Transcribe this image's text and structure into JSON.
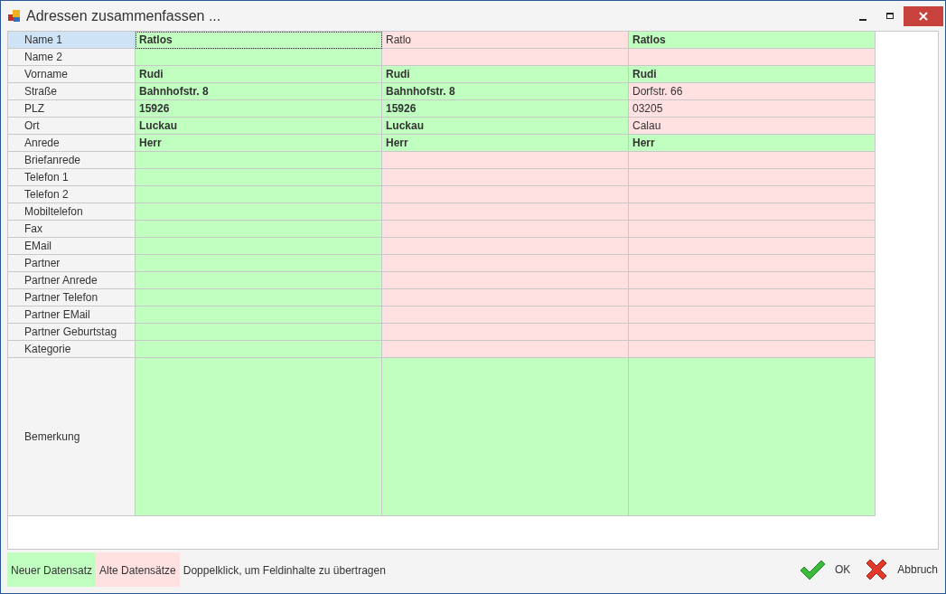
{
  "window": {
    "title": "Adressen zusammenfassen ..."
  },
  "grid": {
    "rows": [
      {
        "label": "Name 1",
        "selected": true,
        "cells": [
          {
            "text": "Ratlos",
            "match": true,
            "focused": true
          },
          {
            "text": "Ratlo",
            "match": false,
            "focused": false
          },
          {
            "text": "Ratlos",
            "match": true,
            "focused": false
          }
        ]
      },
      {
        "label": "Name 2",
        "selected": false,
        "cells": [
          {
            "match": true,
            "focused": false
          },
          {
            "match": false,
            "focused": false
          },
          {
            "match": false,
            "focused": false
          }
        ]
      },
      {
        "label": "Vorname",
        "selected": false,
        "cells": [
          {
            "text": "Rudi",
            "match": true,
            "focused": false
          },
          {
            "text": "Rudi",
            "match": true,
            "focused": false
          },
          {
            "text": "Rudi",
            "match": true,
            "focused": false
          }
        ]
      },
      {
        "label": "Straße",
        "selected": false,
        "cells": [
          {
            "text": "Bahnhofstr. 8",
            "match": true,
            "focused": false
          },
          {
            "text": "Bahnhofstr. 8",
            "match": true,
            "focused": false
          },
          {
            "text": "Dorfstr. 66",
            "match": false,
            "focused": false
          }
        ]
      },
      {
        "label": "PLZ",
        "selected": false,
        "cells": [
          {
            "text": "15926",
            "match": true,
            "focused": false
          },
          {
            "text": "15926",
            "match": true,
            "focused": false
          },
          {
            "text": "03205",
            "match": false,
            "focused": false
          }
        ]
      },
      {
        "label": "Ort",
        "selected": false,
        "cells": [
          {
            "text": "Luckau",
            "match": true,
            "focused": false
          },
          {
            "text": "Luckau",
            "match": true,
            "focused": false
          },
          {
            "text": "Calau",
            "match": false,
            "focused": false
          }
        ]
      },
      {
        "label": "Anrede",
        "selected": false,
        "cells": [
          {
            "text": "Herr",
            "match": true,
            "focused": false
          },
          {
            "text": "Herr",
            "match": true,
            "focused": false
          },
          {
            "text": "Herr",
            "match": true,
            "focused": false
          }
        ]
      },
      {
        "label": "Briefanrede",
        "selected": false,
        "cells": [
          {
            "match": true,
            "focused": false
          },
          {
            "match": false,
            "focused": false
          },
          {
            "match": false,
            "focused": false
          }
        ]
      },
      {
        "label": "Telefon 1",
        "selected": false,
        "cells": [
          {
            "match": true,
            "focused": false
          },
          {
            "match": false,
            "focused": false
          },
          {
            "match": false,
            "focused": false
          }
        ]
      },
      {
        "label": "Telefon 2",
        "selected": false,
        "cells": [
          {
            "match": true,
            "focused": false
          },
          {
            "match": false,
            "focused": false
          },
          {
            "match": false,
            "focused": false
          }
        ]
      },
      {
        "label": "Mobiltelefon",
        "selected": false,
        "cells": [
          {
            "match": true,
            "focused": false
          },
          {
            "match": false,
            "focused": false
          },
          {
            "match": false,
            "focused": false
          }
        ]
      },
      {
        "label": "Fax",
        "selected": false,
        "cells": [
          {
            "match": true,
            "focused": false
          },
          {
            "match": false,
            "focused": false
          },
          {
            "match": false,
            "focused": false
          }
        ]
      },
      {
        "label": "EMail",
        "selected": false,
        "cells": [
          {
            "match": true,
            "focused": false
          },
          {
            "match": false,
            "focused": false
          },
          {
            "match": false,
            "focused": false
          }
        ]
      },
      {
        "label": "Partner",
        "selected": false,
        "cells": [
          {
            "match": true,
            "focused": false
          },
          {
            "match": false,
            "focused": false
          },
          {
            "match": false,
            "focused": false
          }
        ]
      },
      {
        "label": "Partner Anrede",
        "selected": false,
        "cells": [
          {
            "match": true,
            "focused": false
          },
          {
            "match": false,
            "focused": false
          },
          {
            "match": false,
            "focused": false
          }
        ]
      },
      {
        "label": "Partner Telefon",
        "selected": false,
        "cells": [
          {
            "match": true,
            "focused": false
          },
          {
            "match": false,
            "focused": false
          },
          {
            "match": false,
            "focused": false
          }
        ]
      },
      {
        "label": "Partner EMail",
        "selected": false,
        "cells": [
          {
            "match": true,
            "focused": false
          },
          {
            "match": false,
            "focused": false
          },
          {
            "match": false,
            "focused": false
          }
        ]
      },
      {
        "label": "Partner Geburtstag",
        "selected": false,
        "cells": [
          {
            "match": true,
            "focused": false
          },
          {
            "match": false,
            "focused": false
          },
          {
            "match": false,
            "focused": false
          }
        ]
      },
      {
        "label": "Kategorie",
        "selected": false,
        "cells": [
          {
            "match": true,
            "focused": false
          },
          {
            "match": false,
            "focused": false
          },
          {
            "match": false,
            "focused": false
          }
        ]
      },
      {
        "label": "Bemerkung",
        "selected": false,
        "kind": "tall",
        "cells": [
          {
            "match": true,
            "focused": false
          },
          {
            "match": true,
            "focused": false
          },
          {
            "match": true,
            "focused": false
          }
        ]
      }
    ]
  },
  "legend": [
    {
      "text": "Neuer Datensatz",
      "kind": "new"
    },
    {
      "text": "Alte Datensätze",
      "kind": "old"
    },
    {
      "text": "Doppelklick, um Feldinhalte zu übertragen",
      "kind": "hint"
    }
  ],
  "buttons": [
    {
      "label": "OK",
      "kind": "ok"
    },
    {
      "label": "Abbruch",
      "kind": "cancel"
    }
  ]
}
